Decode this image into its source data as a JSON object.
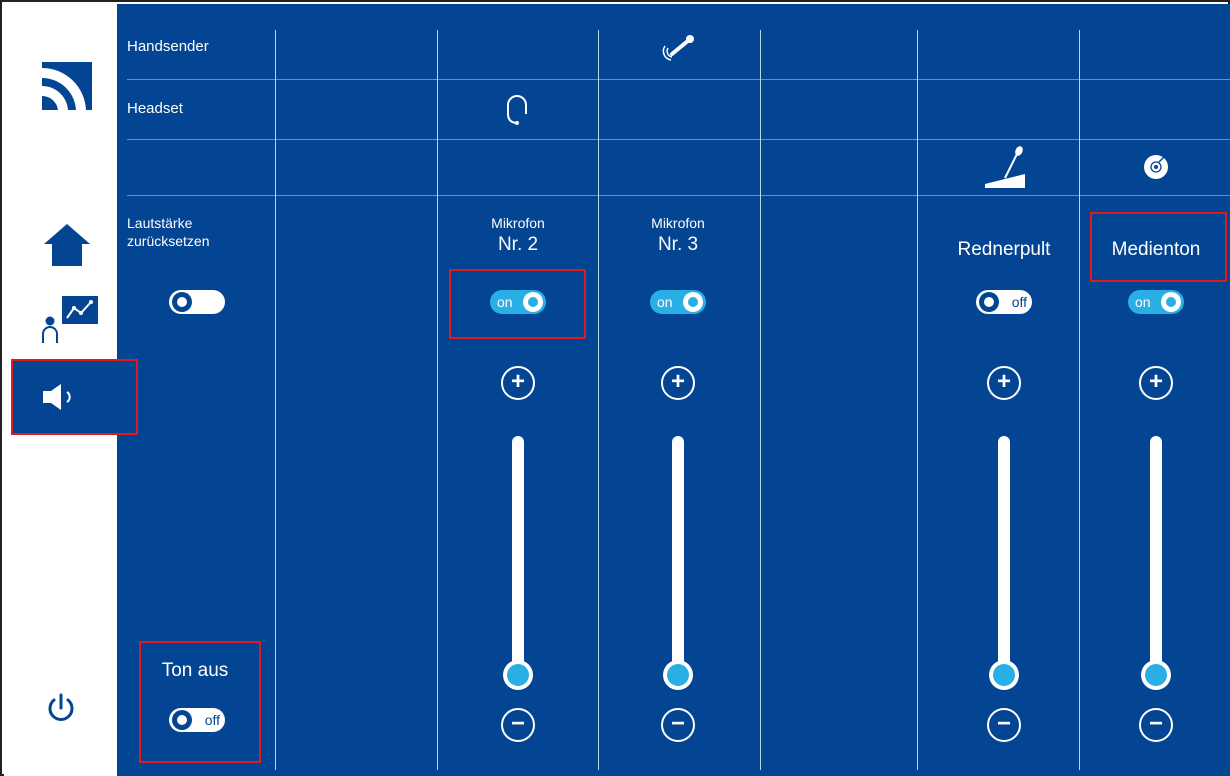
{
  "colors": {
    "panel_bg": "#034592",
    "accent": "#29aee6",
    "highlight": "#e11a1a",
    "text": "#ffffff"
  },
  "sidebar": {
    "logo_icon": "brand-logo-icon",
    "nav": [
      {
        "name": "home",
        "icon": "home-icon"
      },
      {
        "name": "presenter",
        "icon": "presenter-chart-icon"
      },
      {
        "name": "audio",
        "icon": "speaker-icon",
        "active": true
      }
    ],
    "power_icon": "power-icon"
  },
  "rows": {
    "handsender": "Handsender",
    "headset": "Headset"
  },
  "reset": {
    "label_line1": "Lautstärke",
    "label_line2": "zurücksetzen"
  },
  "mute": {
    "label": "Ton aus",
    "toggle_label": "off",
    "state": "off"
  },
  "channels": [
    {
      "id": "mic2",
      "title_small": "Mikrofon",
      "title_big": "Nr. 2",
      "toggle_label": "on",
      "state": "on",
      "icon": "headset-icon",
      "level": 0.0
    },
    {
      "id": "mic3",
      "title_small": "Mikrofon",
      "title_big": "Nr. 3",
      "toggle_label": "on",
      "state": "on",
      "icon": "handheld-mic-icon",
      "level": 0.0
    },
    {
      "id": "lectern",
      "title_big": "Rednerpult",
      "toggle_label": "off",
      "state": "off",
      "icon": "lectern-mic-icon",
      "level": 0.0
    },
    {
      "id": "media",
      "title_big": "Medienton",
      "toggle_label": "on",
      "state": "on",
      "icon": "media-disc-icon",
      "level": 0.0
    }
  ],
  "controls": {
    "plus": "+",
    "minus": "−"
  }
}
